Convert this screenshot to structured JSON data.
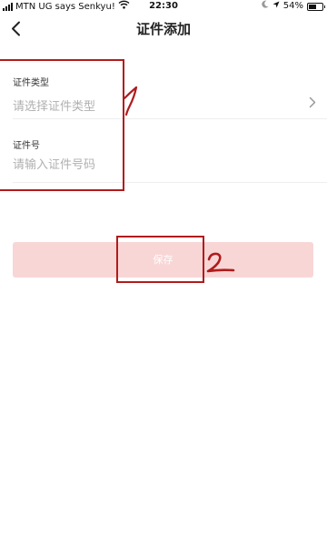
{
  "status_bar": {
    "carrier": "MTN UG says Senkyu!",
    "time": "22:30",
    "battery_percent": "54%",
    "battery_level": 0.54,
    "icons": [
      "signal-icon",
      "wifi-icon",
      "moon-icon",
      "location-arrow-icon",
      "battery-icon"
    ]
  },
  "nav": {
    "title": "证件添加",
    "back_icon": "chevron-left-icon"
  },
  "form": {
    "doc_type": {
      "label": "证件类型",
      "placeholder": "请选择证件类型",
      "icon": "chevron-right-icon"
    },
    "doc_number": {
      "label": "证件号",
      "placeholder": "请输入证件号码"
    }
  },
  "actions": {
    "save_label": "保存"
  },
  "annotations": {
    "mark_1": "1",
    "mark_2": "2",
    "color": "#b01c1c"
  },
  "colors": {
    "save_button_bg": "#f9d6d6",
    "placeholder_text": "#b0b0b0",
    "divider": "#eeeeee"
  }
}
